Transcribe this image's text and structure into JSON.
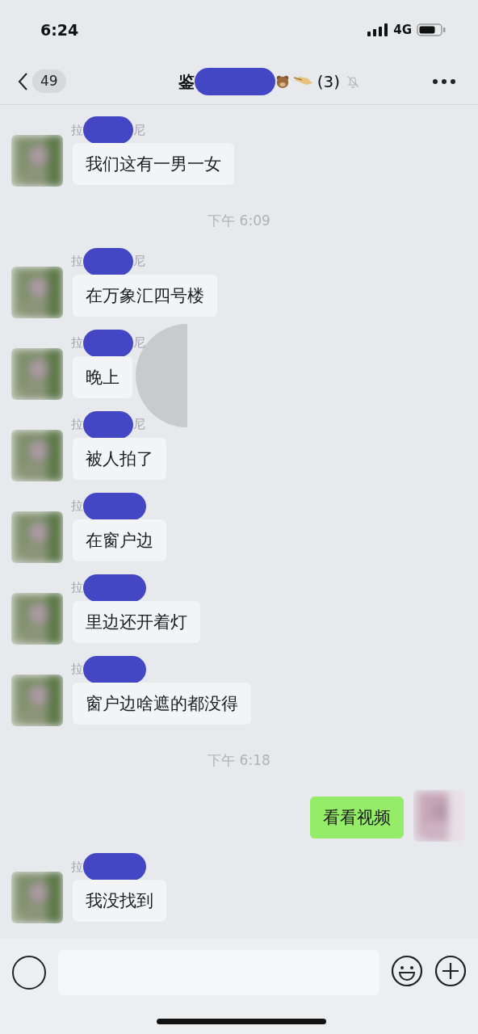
{
  "status_bar": {
    "time": "6:24",
    "network": "4G"
  },
  "header": {
    "back_count": "49",
    "title_start": "鉴",
    "member_count": "(3)",
    "muted": true
  },
  "messages": [
    {
      "kind": "received",
      "sender": [
        "拉",
        "尼"
      ],
      "text": "我们这有一男一女"
    },
    {
      "kind": "time",
      "text": "下午 6:09"
    },
    {
      "kind": "received",
      "sender": [
        "拉",
        "尼"
      ],
      "text": "在万象汇四号楼"
    },
    {
      "kind": "received",
      "sender": [
        "拉",
        "尼"
      ],
      "text": "晚上",
      "covered": true
    },
    {
      "kind": "received",
      "sender": [
        "拉",
        "尼"
      ],
      "text": "被人拍了"
    },
    {
      "kind": "received",
      "sender": [
        "拉"
      ],
      "text": "在窗户边"
    },
    {
      "kind": "received",
      "sender": [
        "拉"
      ],
      "text": "里边还开着灯"
    },
    {
      "kind": "received",
      "sender": [
        "拉"
      ],
      "text": "窗户边啥遮的都没得"
    },
    {
      "kind": "time",
      "text": "下午 6:18"
    },
    {
      "kind": "sent",
      "text": "看看视频"
    },
    {
      "kind": "received",
      "sender": [
        "拉"
      ],
      "text": "我没找到"
    }
  ]
}
